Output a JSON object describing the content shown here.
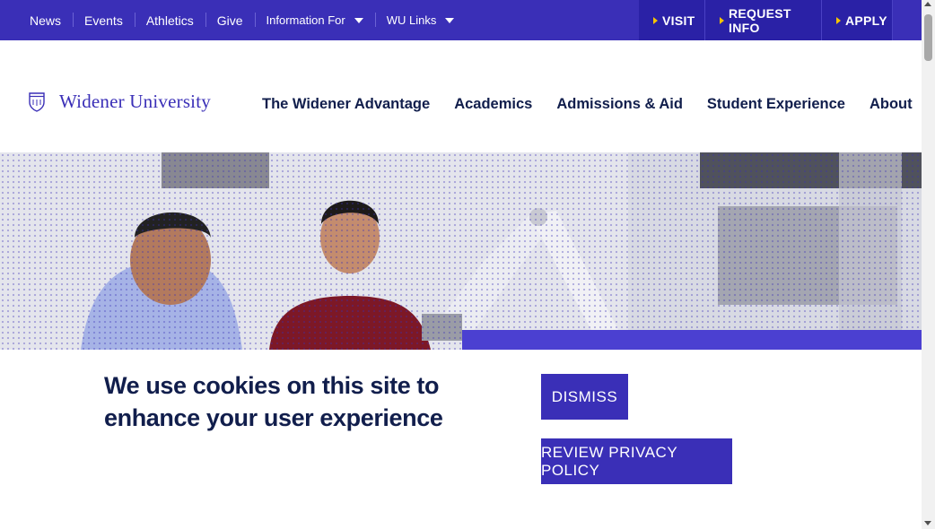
{
  "utility_nav": {
    "links": [
      "News",
      "Events",
      "Athletics",
      "Give"
    ],
    "dropdowns": [
      "Information For",
      "WU Links"
    ]
  },
  "cta": {
    "visit": "VISIT",
    "request_info": "REQUEST INFO",
    "apply": "APPLY"
  },
  "logo": {
    "text": "Widener University"
  },
  "main_nav": {
    "items": [
      "The Widener Advantage",
      "Academics",
      "Admissions & Aid",
      "Student Experience",
      "About"
    ]
  },
  "cookie_banner": {
    "message": "We use cookies on this site to enhance your user experience",
    "dismiss_label": "DISMISS",
    "privacy_label": "REVIEW PRIVACY POLICY"
  },
  "colors": {
    "brand": "#3a2fb7",
    "navy_text": "#111e4c",
    "accent_yellow": "#f5c400"
  },
  "icons": {
    "search": "search-icon",
    "shield": "shield-icon"
  }
}
